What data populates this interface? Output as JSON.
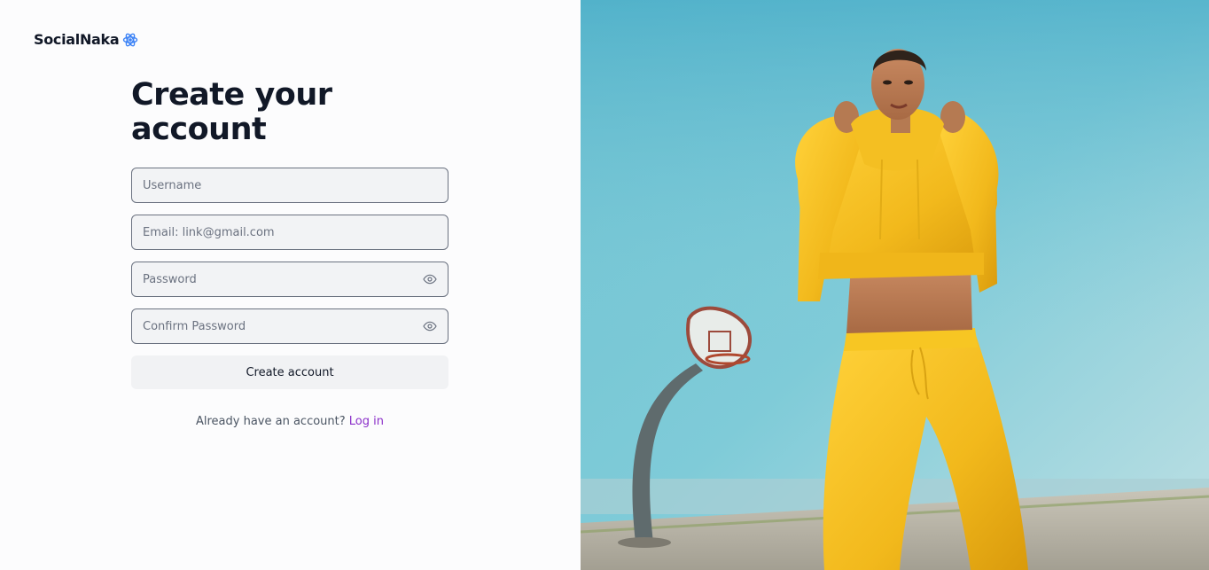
{
  "brand": {
    "name": "SocialNaka",
    "icon": "atom-icon"
  },
  "form": {
    "title": "Create your account",
    "username_placeholder": "Username",
    "email_placeholder": "Email: link@gmail.com",
    "password_placeholder": "Password",
    "confirm_password_placeholder": "Confirm Password",
    "submit_label": "Create account"
  },
  "footer": {
    "prompt": "Already have an account?",
    "login_label": "Log in"
  },
  "colors": {
    "text_dark": "#111827",
    "link_purple": "#8b2fc9",
    "brand_icon_blue": "#3b82f6",
    "input_bg": "#f2f3f5",
    "input_border": "#6b7280"
  },
  "icons": [
    "atom-icon",
    "eye-icon"
  ]
}
